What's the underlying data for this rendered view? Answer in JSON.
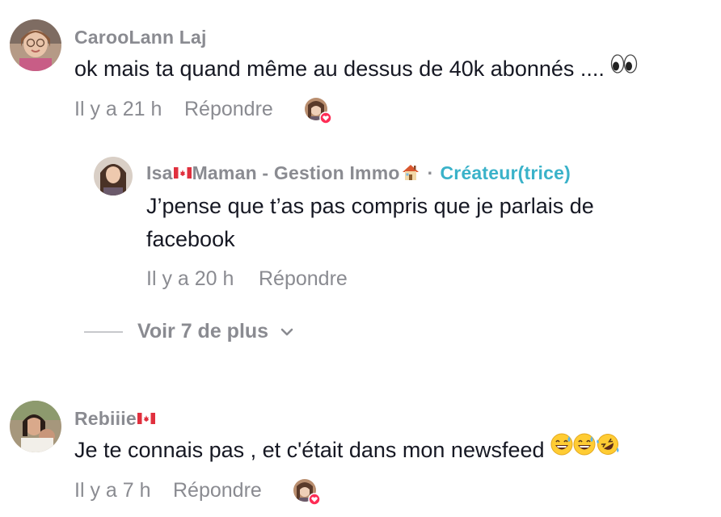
{
  "comments": [
    {
      "username": "CarooLann Laj",
      "text": "ok mais ta quand même au dessus de 40k abonnés ....",
      "text_emoji": "eyes",
      "time": "Il y a 21 h",
      "reply_label": "Répondre",
      "liked_by_creator": true
    },
    {
      "username_part1": "Isa",
      "username_part2": "Maman - Gestion Immo",
      "username_suffix_icon": "house-icon",
      "creator_label": "Créateur(trice)",
      "separator": "·",
      "text_line1": "J’pense que t’as pas compris que je parlais de",
      "text_line2": "facebook",
      "time": "Il y a 20 h",
      "reply_label": "Répondre"
    },
    {
      "username": "Rebiiie",
      "username_suffix_icon": "canada-flag-icon",
      "text": "Je te connais pas , et c'était dans mon newsfeed",
      "text_emojis": [
        "sweat-smile",
        "sweat-smile",
        "rolling-laugh"
      ],
      "time": "Il y a 7 h",
      "reply_label": "Répondre",
      "liked_by_creator": true
    }
  ],
  "view_more": {
    "label": "Voir 7 de plus",
    "icon": "chevron-down-icon"
  },
  "colors": {
    "username": "#8a8b91",
    "text": "#161823",
    "creator": "#3ab2c9",
    "heart": "#fe2c55"
  }
}
